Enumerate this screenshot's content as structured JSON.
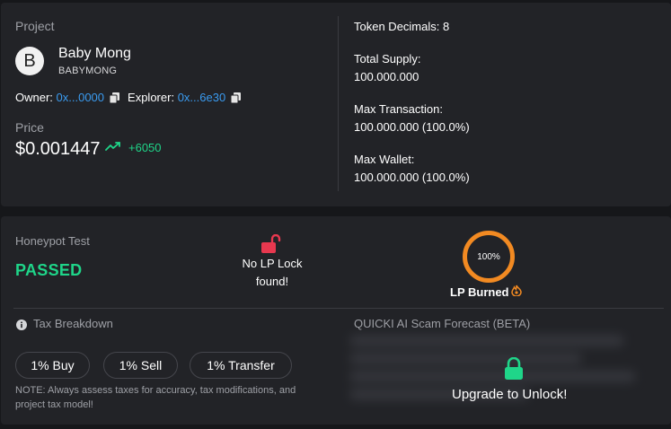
{
  "project": {
    "label": "Project",
    "avatar_letter": "B",
    "name": "Baby Mong",
    "symbol": "BABYMONG",
    "owner_label": "Owner:",
    "owner_value": "0x...0000",
    "explorer_label": "Explorer:",
    "explorer_value": "0x...6e30",
    "price_label": "Price",
    "price": "$0.001447",
    "change": "+6050"
  },
  "stats": {
    "decimals": "Token Decimals: 8",
    "supply_label": "Total Supply:",
    "supply_value": "100.000.000",
    "maxtx_label": "Max Transaction:",
    "maxtx_value": "100.000.000 (100.0%)",
    "maxwallet_label": "Max Wallet:",
    "maxwallet_value": "100.000.000 (100.0%)"
  },
  "honeypot": {
    "label": "Honeypot Test",
    "result": "PASSED"
  },
  "lp_lock": {
    "line1": "No LP Lock",
    "line2": "found!"
  },
  "lp_burn": {
    "percent": "100%",
    "label": "LP Burned"
  },
  "tax": {
    "label": "Tax Breakdown",
    "buy": "1% Buy",
    "sell": "1% Sell",
    "transfer": "1% Transfer",
    "note_line1": "NOTE: Always assess taxes for accuracy, tax modifications, and",
    "note_line2": "project tax model!"
  },
  "forecast": {
    "label": "QUICKI AI Scam Forecast (BETA)",
    "cta": "Upgrade to Unlock!"
  },
  "colors": {
    "background": "#16171a",
    "panel": "#222327",
    "accent_green": "#1fd589",
    "link_blue": "#3a9bf0",
    "lock_red": "#e8384f",
    "ring_orange": "#f28a22"
  }
}
